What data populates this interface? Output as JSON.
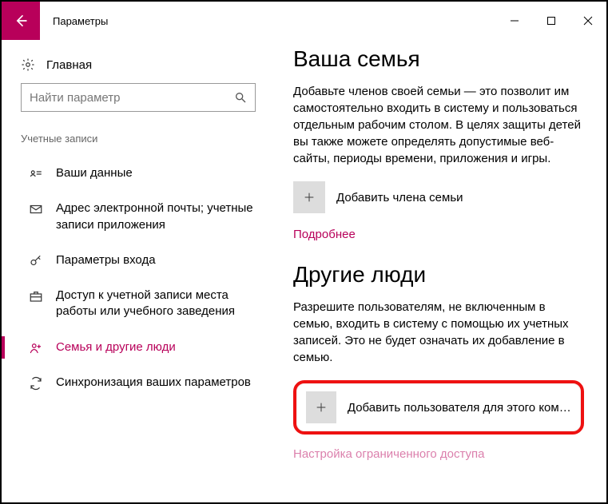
{
  "window": {
    "title": "Параметры"
  },
  "sidebar": {
    "home": "Главная",
    "search_placeholder": "Найти параметр",
    "category": "Учетные записи",
    "items": [
      {
        "label": "Ваши данные"
      },
      {
        "label": "Адрес электронной почты; учетные записи приложения"
      },
      {
        "label": "Параметры входа"
      },
      {
        "label": "Доступ к учетной записи места работы или учебного заведения"
      },
      {
        "label": "Семья и другие люди"
      },
      {
        "label": "Синхронизация ваших параметров"
      }
    ]
  },
  "content": {
    "family": {
      "heading": "Ваша семья",
      "desc": "Добавьте членов своей семьи — это позволит им самостоятельно входить в систему и пользоваться отдельным рабочим столом. В целях защиты детей вы также можете определять допустимые веб-сайты, периоды времени, приложения и игры.",
      "add_label": "Добавить члена семьи",
      "more": "Подробнее"
    },
    "others": {
      "heading": "Другие люди",
      "desc": "Разрешите пользователям, не включенным в семью, входить в систему с помощью их учетных записей. Это не будет означать их добавление в семью.",
      "add_label": "Добавить пользователя для этого компь…",
      "restricted": "Настройка ограниченного доступа"
    }
  }
}
